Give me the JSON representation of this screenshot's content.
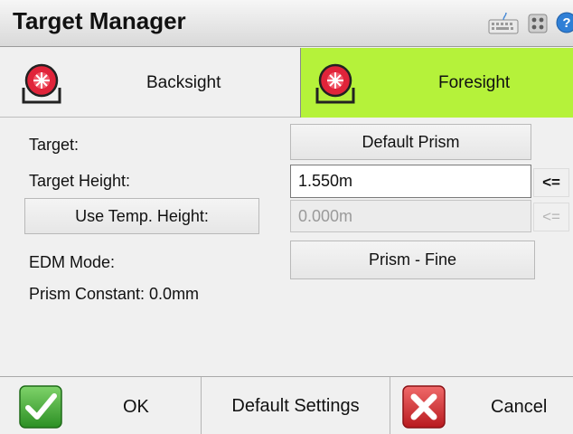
{
  "window": {
    "title": "Target Manager",
    "icons": [
      "keyboard-icon",
      "grid-icon",
      "help-icon"
    ]
  },
  "tabs": [
    {
      "label": "Backsight",
      "icon": "prism-target-icon",
      "selected": false
    },
    {
      "label": "Foresight",
      "icon": "prism-target-icon",
      "selected": true,
      "color": "#b5f23a"
    }
  ],
  "form": {
    "target_label": "Target:",
    "target_value": "Default Prism",
    "target_height_label": "Target Height:",
    "target_height_value": "1.550m",
    "use_temp_height_label": "Use Temp. Height:",
    "temp_height_value": "0.000m",
    "copy_arrow": "<=",
    "copy_arrow_disabled": "<=",
    "edm_mode_label": "EDM Mode:",
    "edm_mode_value": "Prism - Fine",
    "prism_constant_text": "Prism Constant: 0.0mm"
  },
  "bottom": {
    "ok_label": "OK",
    "default_settings_label": "Default Settings",
    "cancel_label": "Cancel"
  },
  "colors": {
    "accent_selected_tab": "#b5f23a",
    "ok_green": "#37a82d",
    "cancel_red": "#d6262b",
    "prism_red": "#e0243a"
  }
}
